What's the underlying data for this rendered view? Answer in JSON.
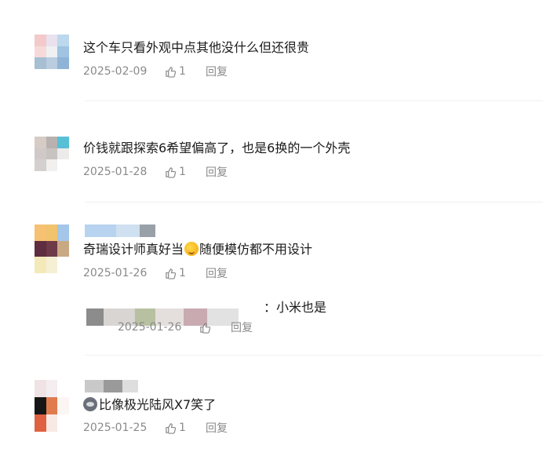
{
  "comments": [
    {
      "text": "这个车只看外观中点其他没什么但还很贵",
      "date": "2025-02-09",
      "likes": "1",
      "reply_label": "回复"
    },
    {
      "text": "价钱就跟探索6希望偏高了，也是6换的一个外壳",
      "date": "2025-01-28",
      "likes": "1",
      "reply_label": "回复"
    },
    {
      "text_before": "奇瑞设计师真好当",
      "text_after": "随便模仿都不用设计",
      "emoji": "laughing-emoji",
      "date": "2025-01-26",
      "likes": "1",
      "reply_label": "回复",
      "sub_reply": {
        "text": "：小米也是",
        "date": "2025-01-26",
        "reply_label": "回复"
      }
    },
    {
      "emoji": "cat-emoji",
      "text": "比像极光陆风X7笑了",
      "date": "2025-01-25",
      "likes": "1",
      "reply_label": "回复"
    }
  ],
  "colors": {
    "text": "#1a1a1a",
    "meta": "#8a8a8a",
    "divider": "#f0f0f0"
  }
}
